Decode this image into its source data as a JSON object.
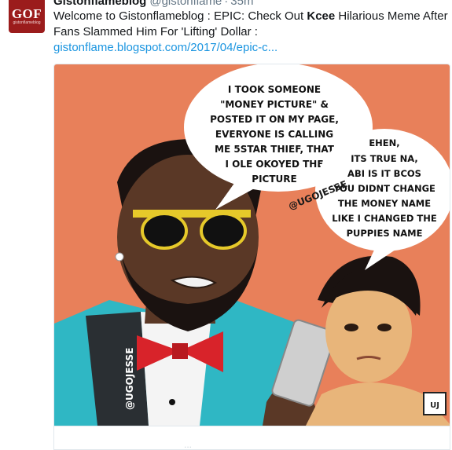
{
  "tweet": {
    "avatar_logo": "GOF",
    "avatar_sub": "gistonflameblog",
    "author_name": "Gistonflameblog",
    "author_handle": "@gistonflame",
    "timestamp": "35m",
    "text_before": "Welcome to Gistonflameblog : EPIC: Check Out ",
    "text_bold": "Kcee",
    "text_after": " Hilarious Meme After Fans Slammed Him For 'Lifting' Dollar : ",
    "link_text": "gistonflame.blogspot.com/2017/04/epic-c...",
    "card_footer_text": "..."
  },
  "meme": {
    "bubble1_lines": [
      "I TOOK SOMEONE",
      "\"MONEY PICTURE\" &",
      "POSTED IT ON MY PAGE,",
      "EVERYONE IS CALLING",
      "ME 5STAR THIEF, THAT",
      "I OLE OKOYED THE",
      "PICTURE"
    ],
    "bubble2_lines": [
      "EHEN,",
      "ITS TRUE NA,",
      "ABI IS IT BCOS",
      "YOU DIDNT CHANGE",
      "THE MONEY NAME",
      "LIKE I CHANGED THE",
      "PUPPIES NAME"
    ],
    "watermark_top": "@UGOJESSE",
    "watermark_side": "@UGOJESSE",
    "badge_text": "UJ"
  },
  "colors": {
    "background_orange": "#e8805a",
    "suit_teal": "#2fb7c4",
    "bowtie_red": "#d8232a",
    "skin_dark": "#5a3826",
    "skin_light": "#e8b57a",
    "link_blue": "#1b95e0"
  }
}
